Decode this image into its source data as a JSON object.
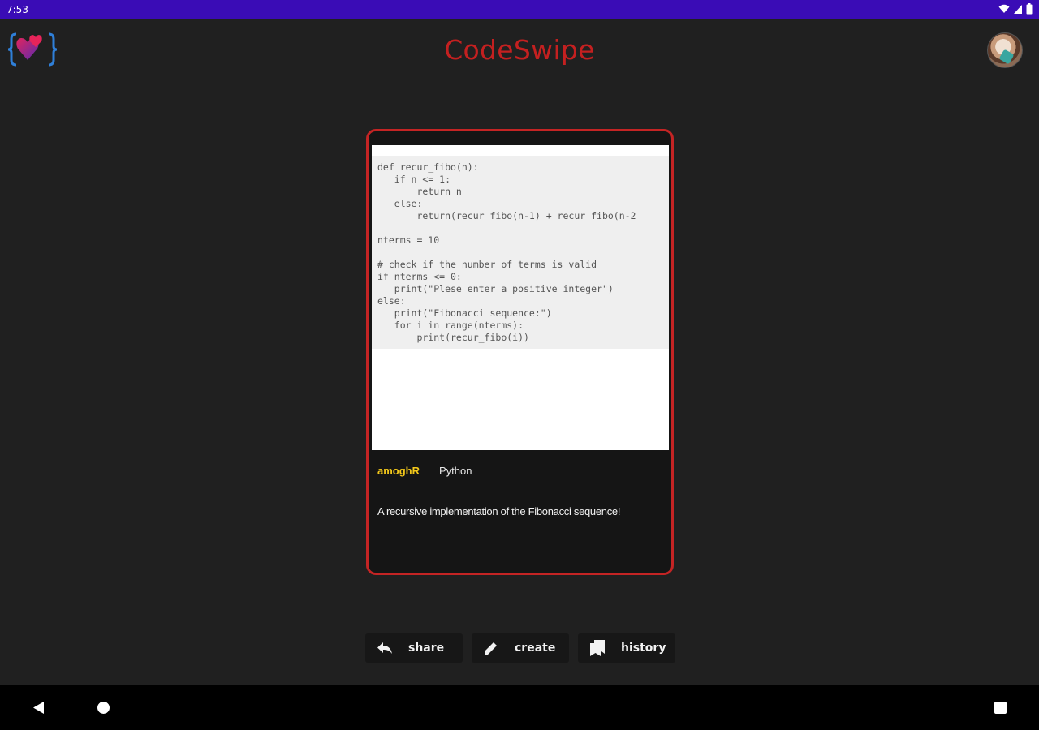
{
  "status_bar": {
    "time": "7:53"
  },
  "app_bar": {
    "title": "CodeSwipe"
  },
  "card": {
    "code_lines": [
      "def recur_fibo(n):",
      "   if n <= 1:",
      "       return n",
      "   else:",
      "       return(recur_fibo(n-1) + recur_fibo(n-2",
      "",
      "nterms = 10",
      "",
      "# check if the number of terms is valid",
      "if nterms <= 0:",
      "   print(\"Plese enter a positive integer\")",
      "else:",
      "   print(\"Fibonacci sequence:\")",
      "   for i in range(nterms):",
      "       print(recur_fibo(i))"
    ],
    "author": "amoghR",
    "language": "Python",
    "description": "A recursive implementation of the Fibonacci sequence!"
  },
  "actions": {
    "share_label": "share",
    "create_label": "create",
    "history_label": "history"
  },
  "colors": {
    "status_bar": "#3a0cb6",
    "title": "#c42020",
    "card_border": "#c42424",
    "author": "#f3c81a"
  },
  "icons": {
    "logo": "heart-braces-logo",
    "share": "reply-arrow-icon",
    "create": "pencil-icon",
    "history": "bookmarks-icon"
  }
}
